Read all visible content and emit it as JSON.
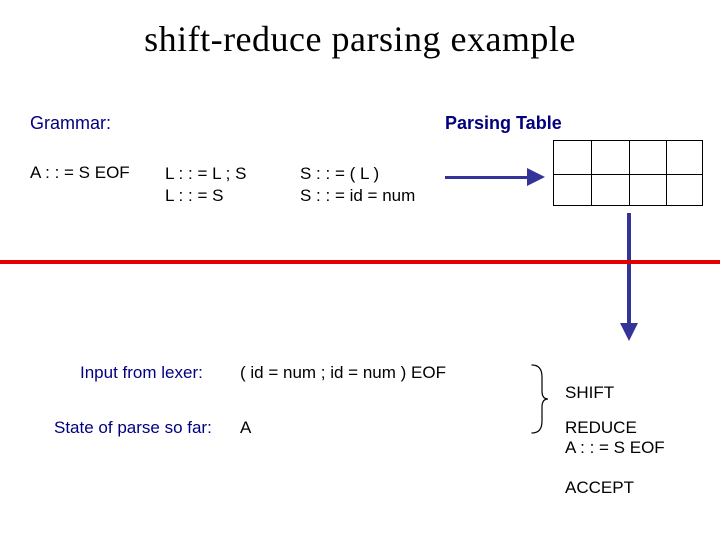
{
  "title": "shift-reduce parsing example",
  "grammar_label": "Grammar:",
  "parsing_table_label": "Parsing Table",
  "productions": {
    "col1": "A : : = S EOF",
    "col2_line1": "L : : = L ; S",
    "col2_line2": "L : : = S",
    "col3_line1": "S : : = ( L )",
    "col3_line2": "S : : = id = num"
  },
  "input_label": "Input from lexer:",
  "input_value": "( id = num ; id = num ) EOF",
  "state_label": "State of parse so far:",
  "state_value": "A",
  "actions": {
    "shift": "SHIFT",
    "reduce_line1": "REDUCE",
    "reduce_line2": "A : : = S EOF",
    "accept": "ACCEPT"
  }
}
